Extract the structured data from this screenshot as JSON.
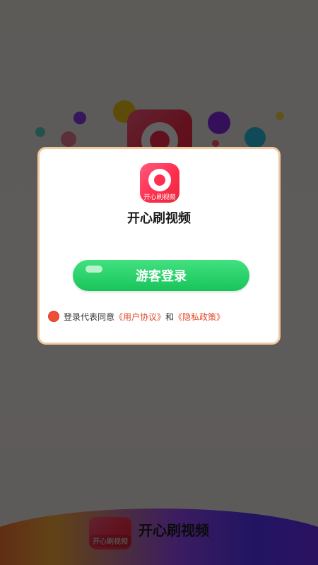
{
  "app": {
    "name": "开心刷视频",
    "icon_label": "开心刷视频"
  },
  "dialog": {
    "guest_login_label": "游客登录",
    "agreement": {
      "prefix": "登录代表同意",
      "user_agreement": "《用户协议》",
      "and": "和",
      "privacy_policy": "《隐私政策》",
      "checked": true
    }
  },
  "colors": {
    "brand_red": "#ff2f4f",
    "button_green": "#18c45a",
    "link_red": "#e34b2c",
    "dialog_border": "#f2c8a0"
  },
  "icons": [
    "play-logo-icon",
    "checkbox-icon"
  ]
}
